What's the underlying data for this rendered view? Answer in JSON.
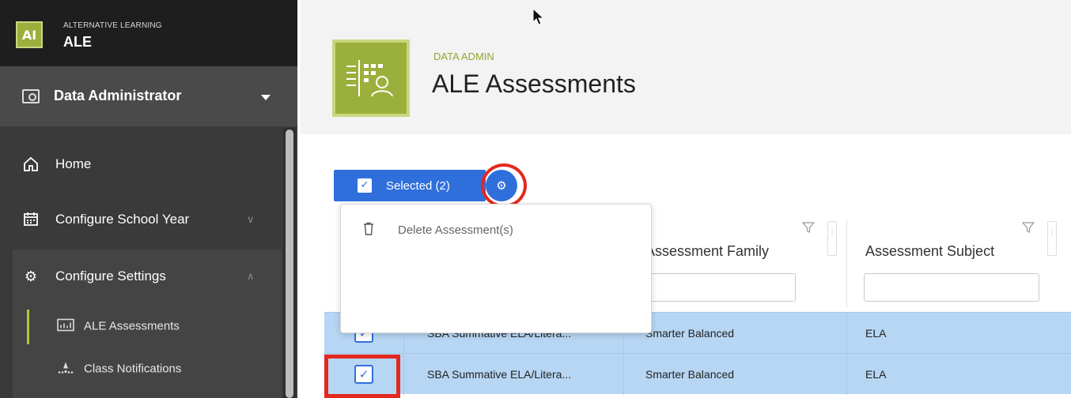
{
  "brand": {
    "logo": "AI",
    "subtitle": "ALTERNATIVE LEARNING",
    "title": "ALE"
  },
  "role": {
    "label": "Data Administrator",
    "icon": "user-card-icon"
  },
  "nav": {
    "items": [
      {
        "label": "Home",
        "icon": "home-icon"
      },
      {
        "label": "Configure School Year",
        "icon": "calendar-icon"
      },
      {
        "label": "Configure Settings",
        "icon": "gear-icon"
      }
    ],
    "sub_items": [
      {
        "label": "ALE Assessments",
        "icon": "chart-icon",
        "active": true
      },
      {
        "label": "Class Notifications",
        "icon": "notification-icon"
      }
    ]
  },
  "header": {
    "eyebrow": "DATA ADMIN",
    "title": "ALE Assessments"
  },
  "toolbar": {
    "selected_label": "Selected (2)"
  },
  "menu": {
    "items": [
      {
        "label": "Delete Assessment(s)",
        "icon": "trash-icon"
      }
    ]
  },
  "table": {
    "columns": [
      "Assessment Family",
      "Assessment Subject"
    ],
    "rows": [
      {
        "name": "SBA Summative ELA/Litera...",
        "family": "Smarter Balanced",
        "subject": "ELA",
        "checked": true
      },
      {
        "name": "SBA Summative ELA/Litera...",
        "family": "Smarter Balanced",
        "subject": "ELA",
        "checked": true
      }
    ]
  },
  "colors": {
    "accent": "#2f6fdc",
    "brand": "#9bb03c",
    "highlight": "#e3281f",
    "row_selected": "#b7d6f3"
  }
}
